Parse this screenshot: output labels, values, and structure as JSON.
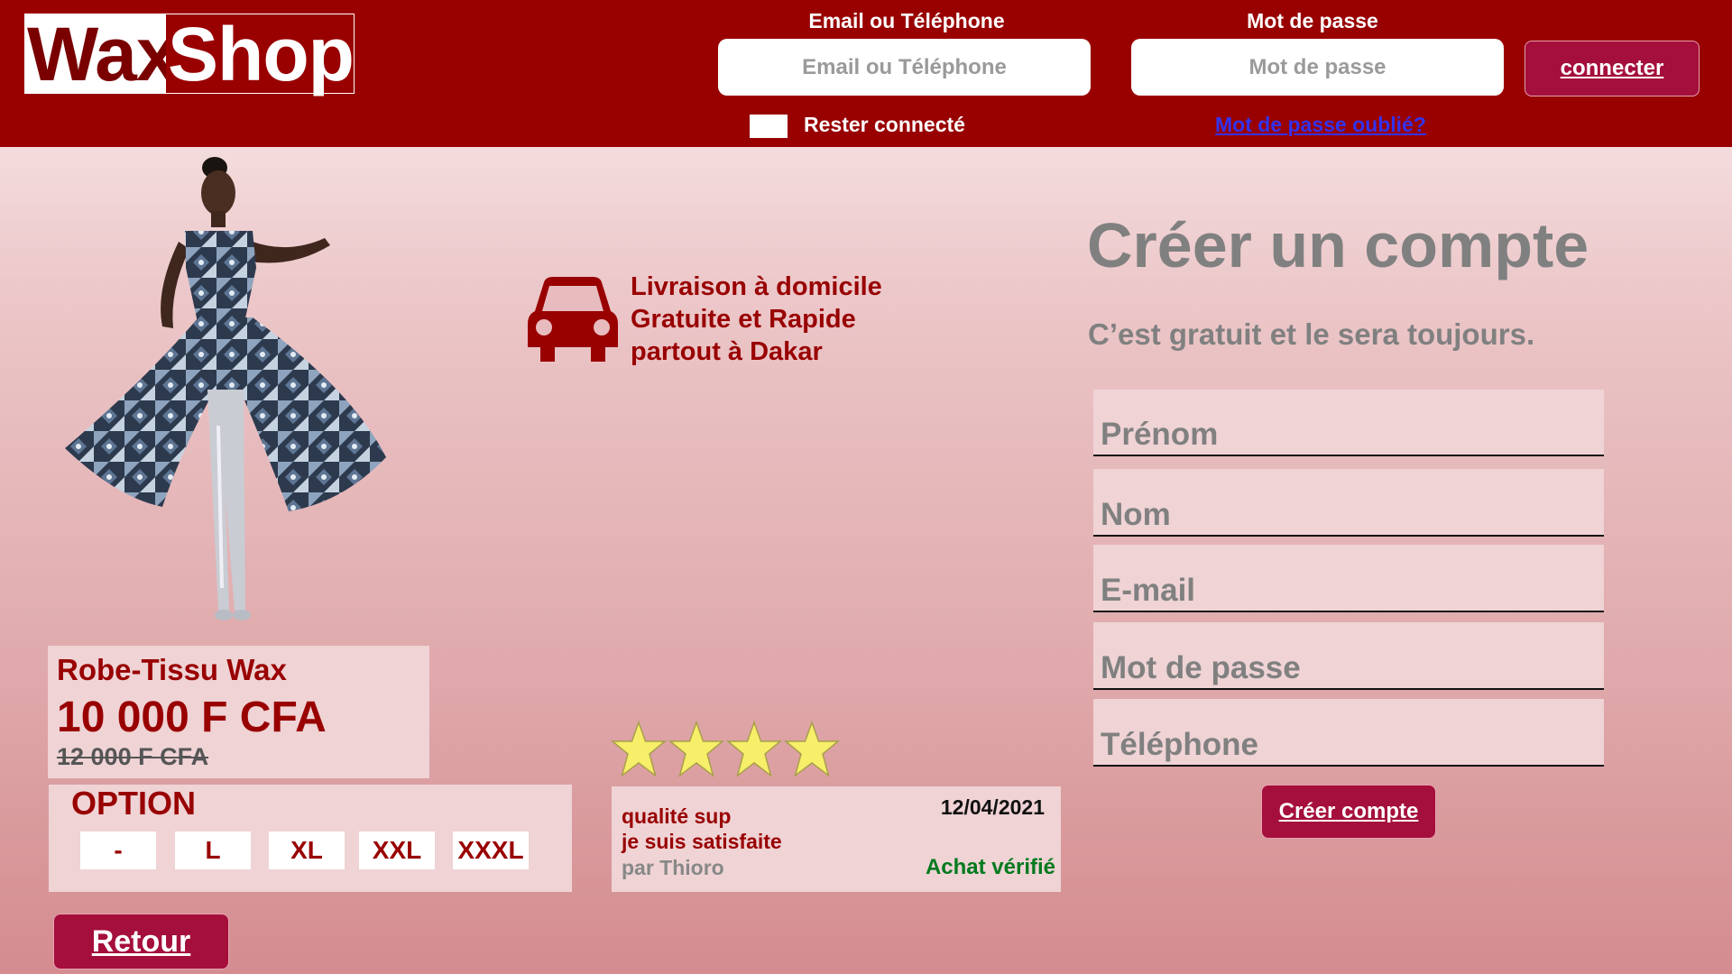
{
  "header": {
    "logo_part1": "Wax",
    "logo_part2": "Shop",
    "email_label": "Email ou Téléphone",
    "email_placeholder": "Email ou Téléphone",
    "password_label": "Mot de passe",
    "password_placeholder": "Mot de passe",
    "connect_label": "connecter",
    "remember_label": "Rester connecté",
    "forgot_label": "Mot de passe oublié?"
  },
  "product": {
    "name": "Robe-Tissu Wax",
    "price": "10 000 F CFA",
    "old_price": "12 000 F CFA",
    "option_title": "OPTION",
    "sizes": [
      "-",
      "L",
      "XL",
      "XXL",
      "XXXL"
    ]
  },
  "delivery": {
    "line1": "Livraison à domicile",
    "line2": "Gratuite et Rapide",
    "line3": "partout à Dakar"
  },
  "review": {
    "rating": 4,
    "text1": "qualité sup",
    "text2": "je suis satisfaite",
    "author": "par Thioro",
    "date": "12/04/2021",
    "verified": "Achat vérifié"
  },
  "back_label": "Retour",
  "register": {
    "title": "Créer un compte",
    "subtitle": "C’est gratuit et le sera toujours.",
    "fields": [
      "Prénom",
      "Nom",
      "E-mail",
      "Mot de passe",
      "Téléphone"
    ],
    "submit_label": "Créer compte"
  },
  "colors": {
    "header_bg": "#990000",
    "accent": "#a50f3b",
    "panel": "#efd3d5",
    "star": "#f7ee6a",
    "verified": "#007a1e"
  },
  "icons": {
    "car": "car-icon",
    "star": "star-icon"
  }
}
